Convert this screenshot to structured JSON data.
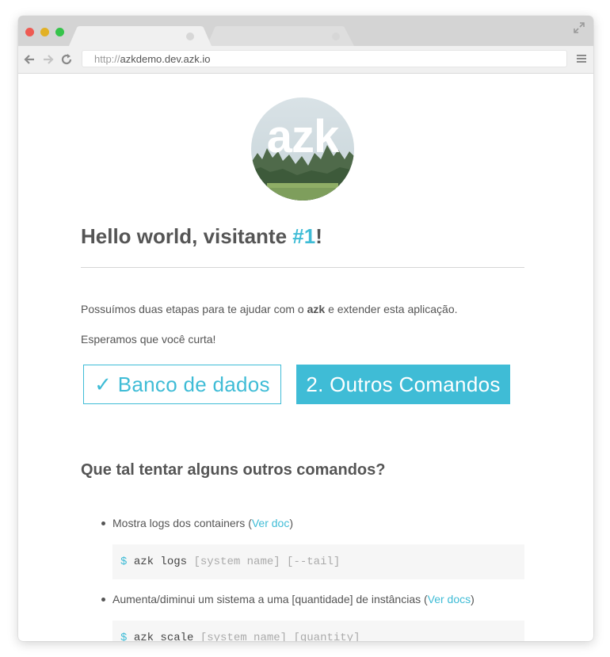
{
  "browser": {
    "url_protocol": "http://",
    "url_host": "azkdemo.dev.azk.io"
  },
  "logo": {
    "text": "azk"
  },
  "page": {
    "heading_prefix": "Hello world, visitante ",
    "heading_count": "#1",
    "heading_suffix": "!",
    "intro_before": "Possuímos duas etapas para te ajudar com o ",
    "intro_bold": "azk",
    "intro_after": " e extender esta aplicação.",
    "intro_second": "Esperamos que você curta!"
  },
  "steps": {
    "step1_label": "✓ Banco de dados",
    "step2_label": "2. Outros Comandos"
  },
  "commands_section": {
    "title": "Que tal tentar alguns outros comandos?",
    "items": [
      {
        "text_before": "Mostra logs dos containers (",
        "link": "Ver doc",
        "text_after": ")",
        "prompt": "$",
        "command": "azk logs",
        "args": "[system name] [--tail]"
      },
      {
        "text_before": "Aumenta/diminui um sistema a uma [quantidade] de instâncias (",
        "link": "Ver docs",
        "text_after": ")",
        "prompt": "$",
        "command": "azk scale",
        "args": "[system name] [quantity]"
      }
    ]
  },
  "colors": {
    "accent": "#3fbcd6",
    "text": "#555555",
    "chrome": "#d4d4d4"
  },
  "icons": [
    "back-icon",
    "forward-icon",
    "reload-icon",
    "menu-icon",
    "expand-icon"
  ]
}
